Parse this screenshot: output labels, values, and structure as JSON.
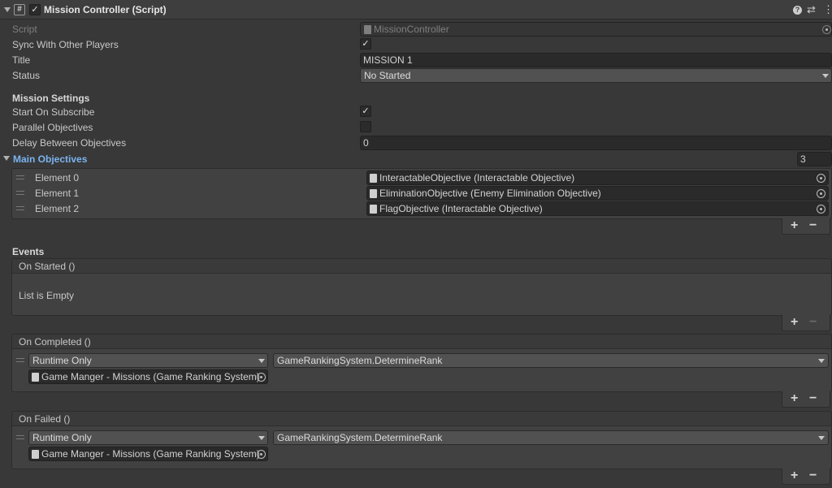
{
  "header": {
    "title": "Mission Controller (Script)",
    "help_icon": "?",
    "settings_icon": "⇄",
    "more_icon": "⋮"
  },
  "script_row": {
    "label": "Script",
    "value": "MissionController"
  },
  "sync": {
    "label": "Sync With Other Players",
    "checked": true
  },
  "title_row": {
    "label": "Title",
    "value": "MISSION 1"
  },
  "status": {
    "label": "Status",
    "value": "No Started"
  },
  "mission_settings": {
    "heading": "Mission Settings",
    "start_on_subscribe": {
      "label": "Start On Subscribe",
      "checked": true
    },
    "parallel_objectives": {
      "label": "Parallel Objectives",
      "checked": false
    },
    "delay": {
      "label": "Delay Between Objectives",
      "value": "0"
    }
  },
  "main_objectives": {
    "label": "Main Objectives",
    "count": "3",
    "elements": [
      {
        "label": "Element 0",
        "value": "InteractableObjective (Interactable Objective)"
      },
      {
        "label": "Element 1",
        "value": "EliminationObjective (Enemy Elimination Objective)"
      },
      {
        "label": "Element 2",
        "value": "FlagObjective (Interactable Objective)"
      }
    ]
  },
  "events": {
    "heading": "Events",
    "on_started": {
      "label": "On Started ()",
      "empty_text": "List is Empty"
    },
    "on_completed": {
      "label": "On Completed ()",
      "mode": "Runtime Only",
      "function": "GameRankingSystem.DetermineRank",
      "target": "Game Manger - Missions (Game Ranking System)"
    },
    "on_failed": {
      "label": "On Failed ()",
      "mode": "Runtime Only",
      "function": "GameRankingSystem.DetermineRank",
      "target": "Game Manger - Missions (Game Ranking System)"
    }
  },
  "buttons": {
    "plus": "+",
    "minus": "−"
  },
  "colors": {
    "accent_blue": "#7bb3f0",
    "background": "#383838"
  }
}
